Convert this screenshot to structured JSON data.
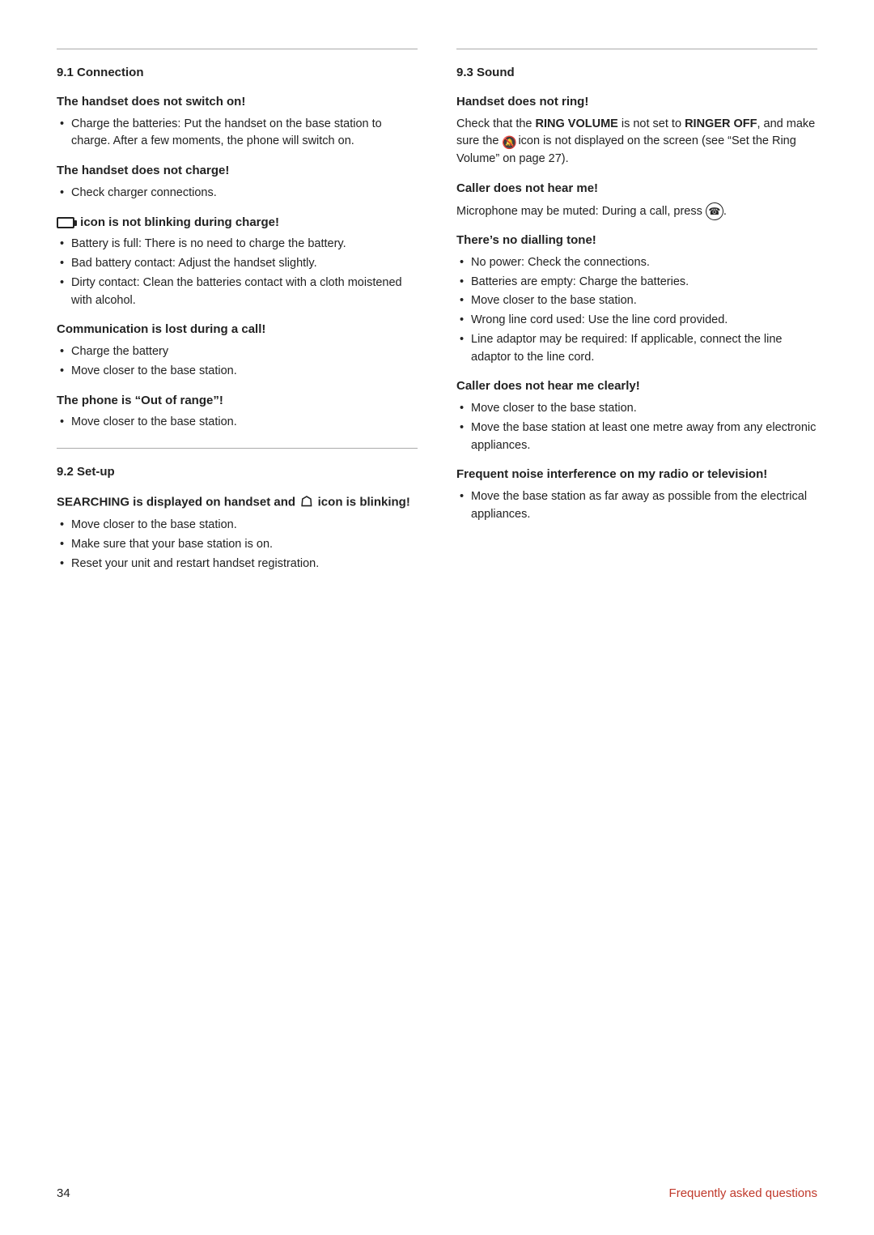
{
  "left_col": {
    "section91": {
      "title": "9.1    Connection",
      "blocks": [
        {
          "heading": "The handset does not switch on!",
          "bullets": [
            "Charge the batteries: Put the handset on the base station to charge. After a few moments, the phone will switch on."
          ]
        },
        {
          "heading": "The handset does not charge!",
          "bullets": [
            "Check charger connections."
          ]
        },
        {
          "heading_prefix": "battery_icon",
          "heading": " icon is not blinking during charge!",
          "bullets": [
            "Battery is full: There is no need to charge the battery.",
            "Bad battery contact: Adjust the handset slightly.",
            "Dirty contact: Clean the batteries contact with a cloth moistened with alcohol."
          ]
        },
        {
          "heading": "Communication is lost during a call!",
          "bullets": [
            "Charge the battery",
            "Move closer to the base station."
          ]
        },
        {
          "heading": "The phone is “Out of range”!",
          "bullets": [
            "Move closer to the base station."
          ]
        }
      ]
    },
    "section92": {
      "title": "9.2    Set-up",
      "blocks": [
        {
          "heading_prefix": "SEARCHING",
          "heading": "SEARCHING is displayed on handset and",
          "heading_suffix": " icon is blinking!",
          "has_signal_icon": true,
          "bullets": [
            "Move closer to the base station.",
            "Make sure that your base station is on.",
            "Reset your unit and restart handset registration."
          ]
        }
      ]
    }
  },
  "right_col": {
    "section93": {
      "title": "9.3    Sound",
      "blocks": [
        {
          "heading": "Handset does not ring!",
          "body": "Check that the RING VOLUME is not set to RINGER OFF, and make sure the",
          "body2": "icon is not displayed on the screen (see “Set the Ring Volume” on page 27).",
          "has_mute_icon": true
        },
        {
          "heading": "Caller does not hear me!",
          "body": "Microphone may be muted: During a call, press",
          "has_mic_btn": true,
          "body_end": "."
        },
        {
          "heading": "There’s no dialling tone!",
          "bullets": [
            "No power: Check the connections.",
            "Batteries are empty: Charge the batteries.",
            "Move closer to the base station.",
            "Wrong line cord used: Use the line cord provided.",
            "Line adaptor may be required: If applicable, connect the line adaptor to the line cord."
          ]
        },
        {
          "heading": "Caller does not hear me clearly!",
          "bullets": [
            "Move closer to the base station.",
            "Move the base station at least one metre away from any electronic appliances."
          ]
        },
        {
          "heading": "Frequent noise interference on my radio or television!",
          "bullets": [
            "Move the base station as far away as possible from the electrical appliances."
          ]
        }
      ]
    }
  },
  "footer": {
    "page_number": "34",
    "faq_label": "Frequently asked questions"
  }
}
